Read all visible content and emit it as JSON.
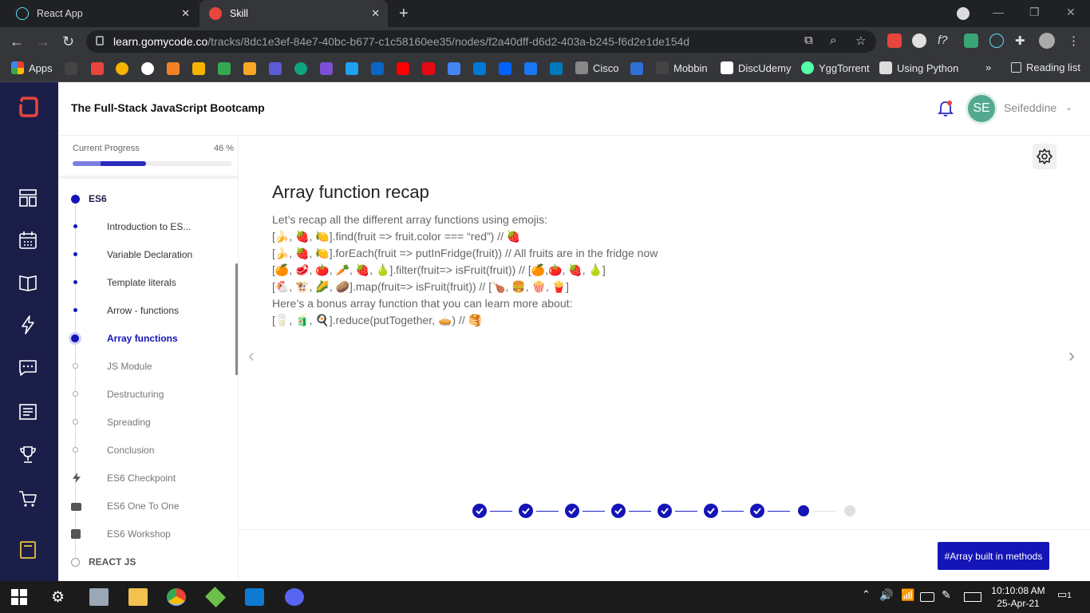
{
  "browser": {
    "tabs": [
      {
        "title": "React App",
        "active": false
      },
      {
        "title": "Skill",
        "active": true
      }
    ],
    "url_host": "learn.gomycode.co",
    "url_path": "/tracks/8dc1e3ef-84e7-40bc-b677-c1c58160ee35/nodes/f2a40dff-d6d2-403a-b245-f6d2e1de154d",
    "bookmarks": [
      "Apps",
      "Cisco",
      "Mobbin",
      "DiscUdemy",
      "YggTorrent",
      "Using Python"
    ],
    "reading_list": "Reading list",
    "more": "»"
  },
  "header": {
    "course_title": "The Full-Stack JavaScript Bootcamp",
    "avatar_initials": "SE",
    "username": "Seifeddine"
  },
  "progress": {
    "label": "Current Progress",
    "value_text": "46 %",
    "fraction": 0.46
  },
  "sidebar": {
    "items": [
      {
        "label": "ES6",
        "kind": "section",
        "state": "done"
      },
      {
        "label": "Introduction to ES...",
        "kind": "lesson",
        "state": "done"
      },
      {
        "label": "Variable Declaration",
        "kind": "lesson",
        "state": "done"
      },
      {
        "label": "Template literals",
        "kind": "lesson",
        "state": "done"
      },
      {
        "label": "Arrow - functions",
        "kind": "lesson",
        "state": "done"
      },
      {
        "label": "Array functions",
        "kind": "lesson",
        "state": "current"
      },
      {
        "label": "JS Module",
        "kind": "lesson",
        "state": "todo"
      },
      {
        "label": "Destructuring",
        "kind": "lesson",
        "state": "todo"
      },
      {
        "label": "Spreading",
        "kind": "lesson",
        "state": "todo"
      },
      {
        "label": "Conclusion",
        "kind": "lesson",
        "state": "todo"
      },
      {
        "label": "ES6 Checkpoint",
        "kind": "checkpoint",
        "state": "todo"
      },
      {
        "label": "ES6 One To One",
        "kind": "one-to-one",
        "state": "todo"
      },
      {
        "label": "ES6 Workshop",
        "kind": "workshop",
        "state": "todo"
      },
      {
        "label": "REACT JS",
        "kind": "section",
        "state": "todo"
      }
    ]
  },
  "lesson": {
    "title": "Array function recap",
    "lines": [
      "Let’s recap all the different array functions using emojis:",
      "[🍌, 🍓, 🍋].find(fruit => fruit.color === “red”) // 🍓",
      "[🍌, 🍓, 🍋].forEach(fruit => putInFridge(fruit)) // All fruits are in the fridge now",
      "[🍊, 🥩, 🍅, 🥕, 🍓, 🍐].filter(fruit=> isFruit(fruit)) // [🍊,🍅, 🍓, 🍐]",
      "[🐔, 🐮, 🌽, 🥔].map(fruit=> isFruit(fruit)) // [🍗, 🍔, 🍿, 🍟]",
      "Here’s a bonus array function that you can learn more about:",
      "[🥛, 🧃, 🍳].reduce(putTogether, 🥧) // 🥞"
    ]
  },
  "steps": {
    "states": [
      "done",
      "done",
      "done",
      "done",
      "done",
      "done",
      "done",
      "current",
      "todo"
    ]
  },
  "footer": {
    "tag_button": "#Array built in methods"
  },
  "taskbar": {
    "time": "10:10:08 AM",
    "date": "25-Apr-21",
    "notifications": "1"
  },
  "colors": {
    "accent": "#1414b8",
    "leftnav_bg": "#1c1e4a",
    "icon_accent": "#e8c43a",
    "brand_red": "#e8453c"
  }
}
